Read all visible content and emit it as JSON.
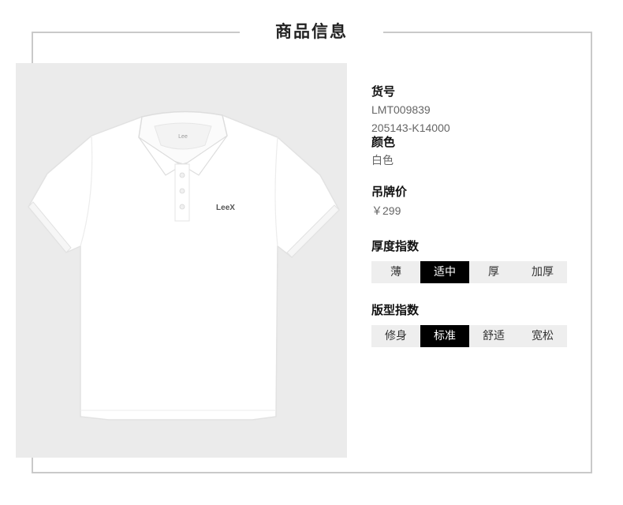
{
  "header": {
    "title": "商品信息"
  },
  "product_image": {
    "alt": "white polo shirt",
    "brand_mark": "LeeX",
    "collar_tag": "Lee"
  },
  "info": {
    "sku": {
      "label": "货号",
      "values": [
        "LMT009839",
        "205143-K14000"
      ]
    },
    "color": {
      "label": "颜色",
      "value": "白色"
    },
    "price": {
      "label": "吊牌价",
      "value": "￥299"
    }
  },
  "thickness": {
    "label": "厚度指数",
    "options": [
      "薄",
      "适中",
      "厚",
      "加厚"
    ],
    "selected": "适中"
  },
  "fit": {
    "label": "版型指数",
    "options": [
      "修身",
      "标准",
      "舒适",
      "宽松"
    ],
    "selected": "标准"
  },
  "colors": {
    "frame": "#c9c9c9",
    "panel_bg": "#ebebeb",
    "active_bg": "#000000",
    "inactive_bg": "#eeeeee"
  }
}
